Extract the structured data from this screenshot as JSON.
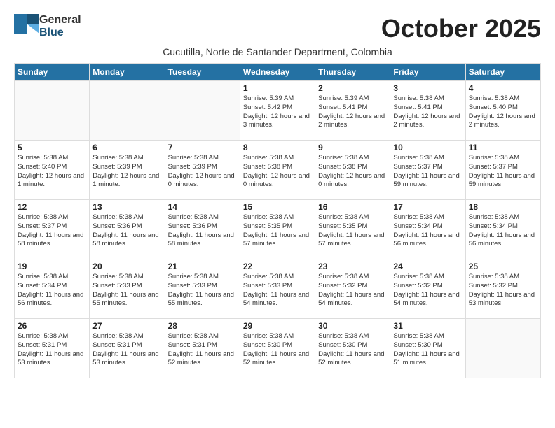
{
  "header": {
    "logo_general": "General",
    "logo_blue": "Blue",
    "title": "October 2025",
    "subtitle": "Cucutilla, Norte de Santander Department, Colombia"
  },
  "days_of_week": [
    "Sunday",
    "Monday",
    "Tuesday",
    "Wednesday",
    "Thursday",
    "Friday",
    "Saturday"
  ],
  "weeks": [
    [
      {
        "day": "",
        "empty": true
      },
      {
        "day": "",
        "empty": true
      },
      {
        "day": "",
        "empty": true
      },
      {
        "day": "1",
        "sunrise": "Sunrise: 5:39 AM",
        "sunset": "Sunset: 5:42 PM",
        "daylight": "Daylight: 12 hours and 3 minutes."
      },
      {
        "day": "2",
        "sunrise": "Sunrise: 5:39 AM",
        "sunset": "Sunset: 5:41 PM",
        "daylight": "Daylight: 12 hours and 2 minutes."
      },
      {
        "day": "3",
        "sunrise": "Sunrise: 5:38 AM",
        "sunset": "Sunset: 5:41 PM",
        "daylight": "Daylight: 12 hours and 2 minutes."
      },
      {
        "day": "4",
        "sunrise": "Sunrise: 5:38 AM",
        "sunset": "Sunset: 5:40 PM",
        "daylight": "Daylight: 12 hours and 2 minutes."
      }
    ],
    [
      {
        "day": "5",
        "sunrise": "Sunrise: 5:38 AM",
        "sunset": "Sunset: 5:40 PM",
        "daylight": "Daylight: 12 hours and 1 minute."
      },
      {
        "day": "6",
        "sunrise": "Sunrise: 5:38 AM",
        "sunset": "Sunset: 5:39 PM",
        "daylight": "Daylight: 12 hours and 1 minute."
      },
      {
        "day": "7",
        "sunrise": "Sunrise: 5:38 AM",
        "sunset": "Sunset: 5:39 PM",
        "daylight": "Daylight: 12 hours and 0 minutes."
      },
      {
        "day": "8",
        "sunrise": "Sunrise: 5:38 AM",
        "sunset": "Sunset: 5:38 PM",
        "daylight": "Daylight: 12 hours and 0 minutes."
      },
      {
        "day": "9",
        "sunrise": "Sunrise: 5:38 AM",
        "sunset": "Sunset: 5:38 PM",
        "daylight": "Daylight: 12 hours and 0 minutes."
      },
      {
        "day": "10",
        "sunrise": "Sunrise: 5:38 AM",
        "sunset": "Sunset: 5:37 PM",
        "daylight": "Daylight: 11 hours and 59 minutes."
      },
      {
        "day": "11",
        "sunrise": "Sunrise: 5:38 AM",
        "sunset": "Sunset: 5:37 PM",
        "daylight": "Daylight: 11 hours and 59 minutes."
      }
    ],
    [
      {
        "day": "12",
        "sunrise": "Sunrise: 5:38 AM",
        "sunset": "Sunset: 5:37 PM",
        "daylight": "Daylight: 11 hours and 58 minutes."
      },
      {
        "day": "13",
        "sunrise": "Sunrise: 5:38 AM",
        "sunset": "Sunset: 5:36 PM",
        "daylight": "Daylight: 11 hours and 58 minutes."
      },
      {
        "day": "14",
        "sunrise": "Sunrise: 5:38 AM",
        "sunset": "Sunset: 5:36 PM",
        "daylight": "Daylight: 11 hours and 58 minutes."
      },
      {
        "day": "15",
        "sunrise": "Sunrise: 5:38 AM",
        "sunset": "Sunset: 5:35 PM",
        "daylight": "Daylight: 11 hours and 57 minutes."
      },
      {
        "day": "16",
        "sunrise": "Sunrise: 5:38 AM",
        "sunset": "Sunset: 5:35 PM",
        "daylight": "Daylight: 11 hours and 57 minutes."
      },
      {
        "day": "17",
        "sunrise": "Sunrise: 5:38 AM",
        "sunset": "Sunset: 5:34 PM",
        "daylight": "Daylight: 11 hours and 56 minutes."
      },
      {
        "day": "18",
        "sunrise": "Sunrise: 5:38 AM",
        "sunset": "Sunset: 5:34 PM",
        "daylight": "Daylight: 11 hours and 56 minutes."
      }
    ],
    [
      {
        "day": "19",
        "sunrise": "Sunrise: 5:38 AM",
        "sunset": "Sunset: 5:34 PM",
        "daylight": "Daylight: 11 hours and 56 minutes."
      },
      {
        "day": "20",
        "sunrise": "Sunrise: 5:38 AM",
        "sunset": "Sunset: 5:33 PM",
        "daylight": "Daylight: 11 hours and 55 minutes."
      },
      {
        "day": "21",
        "sunrise": "Sunrise: 5:38 AM",
        "sunset": "Sunset: 5:33 PM",
        "daylight": "Daylight: 11 hours and 55 minutes."
      },
      {
        "day": "22",
        "sunrise": "Sunrise: 5:38 AM",
        "sunset": "Sunset: 5:33 PM",
        "daylight": "Daylight: 11 hours and 54 minutes."
      },
      {
        "day": "23",
        "sunrise": "Sunrise: 5:38 AM",
        "sunset": "Sunset: 5:32 PM",
        "daylight": "Daylight: 11 hours and 54 minutes."
      },
      {
        "day": "24",
        "sunrise": "Sunrise: 5:38 AM",
        "sunset": "Sunset: 5:32 PM",
        "daylight": "Daylight: 11 hours and 54 minutes."
      },
      {
        "day": "25",
        "sunrise": "Sunrise: 5:38 AM",
        "sunset": "Sunset: 5:32 PM",
        "daylight": "Daylight: 11 hours and 53 minutes."
      }
    ],
    [
      {
        "day": "26",
        "sunrise": "Sunrise: 5:38 AM",
        "sunset": "Sunset: 5:31 PM",
        "daylight": "Daylight: 11 hours and 53 minutes."
      },
      {
        "day": "27",
        "sunrise": "Sunrise: 5:38 AM",
        "sunset": "Sunset: 5:31 PM",
        "daylight": "Daylight: 11 hours and 53 minutes."
      },
      {
        "day": "28",
        "sunrise": "Sunrise: 5:38 AM",
        "sunset": "Sunset: 5:31 PM",
        "daylight": "Daylight: 11 hours and 52 minutes."
      },
      {
        "day": "29",
        "sunrise": "Sunrise: 5:38 AM",
        "sunset": "Sunset: 5:30 PM",
        "daylight": "Daylight: 11 hours and 52 minutes."
      },
      {
        "day": "30",
        "sunrise": "Sunrise: 5:38 AM",
        "sunset": "Sunset: 5:30 PM",
        "daylight": "Daylight: 11 hours and 52 minutes."
      },
      {
        "day": "31",
        "sunrise": "Sunrise: 5:38 AM",
        "sunset": "Sunset: 5:30 PM",
        "daylight": "Daylight: 11 hours and 51 minutes."
      },
      {
        "day": "",
        "empty": true
      }
    ]
  ]
}
